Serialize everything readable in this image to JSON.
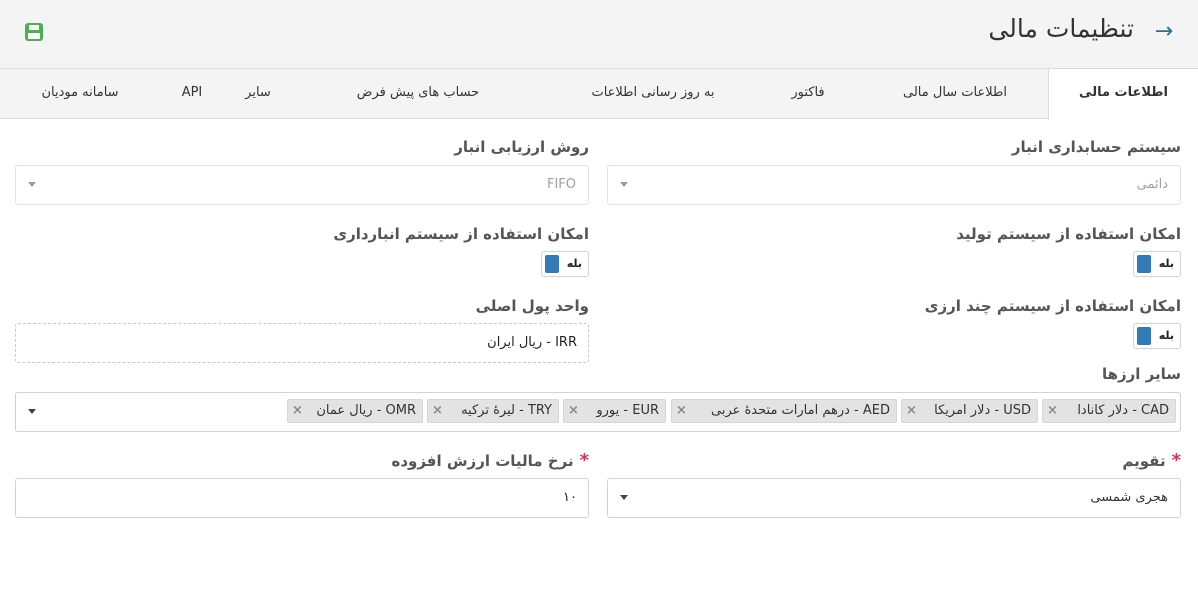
{
  "header": {
    "title": "تنظیمات مالی",
    "back_icon": "arrow-right-icon",
    "save_icon": "save-icon",
    "accent_color": "#2f6f8f",
    "save_color": "#4caf50"
  },
  "tabs": [
    {
      "label": "اطلاعات مالی",
      "active": true
    },
    {
      "label": "اطلاعات سال مالی",
      "active": false
    },
    {
      "label": "فاکتور",
      "active": false
    },
    {
      "label": "به روز رسانی اطلاعات",
      "active": false
    },
    {
      "label": "حساب های پیش فرض",
      "active": false
    },
    {
      "label": "سایر",
      "active": false
    },
    {
      "label": "API",
      "active": false
    },
    {
      "label": "سامانه مودیان",
      "active": false
    }
  ],
  "form": {
    "inventory_accounting": {
      "label": "سیستم حسابداری انبار",
      "value": "دائمی"
    },
    "inventory_valuation": {
      "label": "روش ارزیابی انبار",
      "value": "FIFO"
    },
    "production_system": {
      "label": "امکان استفاده از سیستم تولید",
      "value": "بله"
    },
    "warehouse_system": {
      "label": "امکان استفاده از سیستم انبارداری",
      "value": "بله"
    },
    "multi_currency": {
      "label": "امکان استفاده از سیستم چند ارزی",
      "value": "بله"
    },
    "base_currency": {
      "label": "واحد پول اصلی",
      "value": "IRR - ریال ایران"
    },
    "other_currencies": {
      "label": "سایر ارزها",
      "items": [
        "CAD - دلار کانادا",
        "USD - دلار امریکا",
        "AED - درهم امارات متحدهٔ عربی",
        "EUR - یورو",
        "TRY - لیرهٔ ترکیه",
        "OMR - ریال عمان"
      ]
    },
    "calendar": {
      "label": "تقویم",
      "value": "هجری شمسی",
      "required": "*"
    },
    "vat_rate": {
      "label": "نرخ مالیات ارزش افزوده",
      "value": "۱۰",
      "required": "*"
    }
  }
}
